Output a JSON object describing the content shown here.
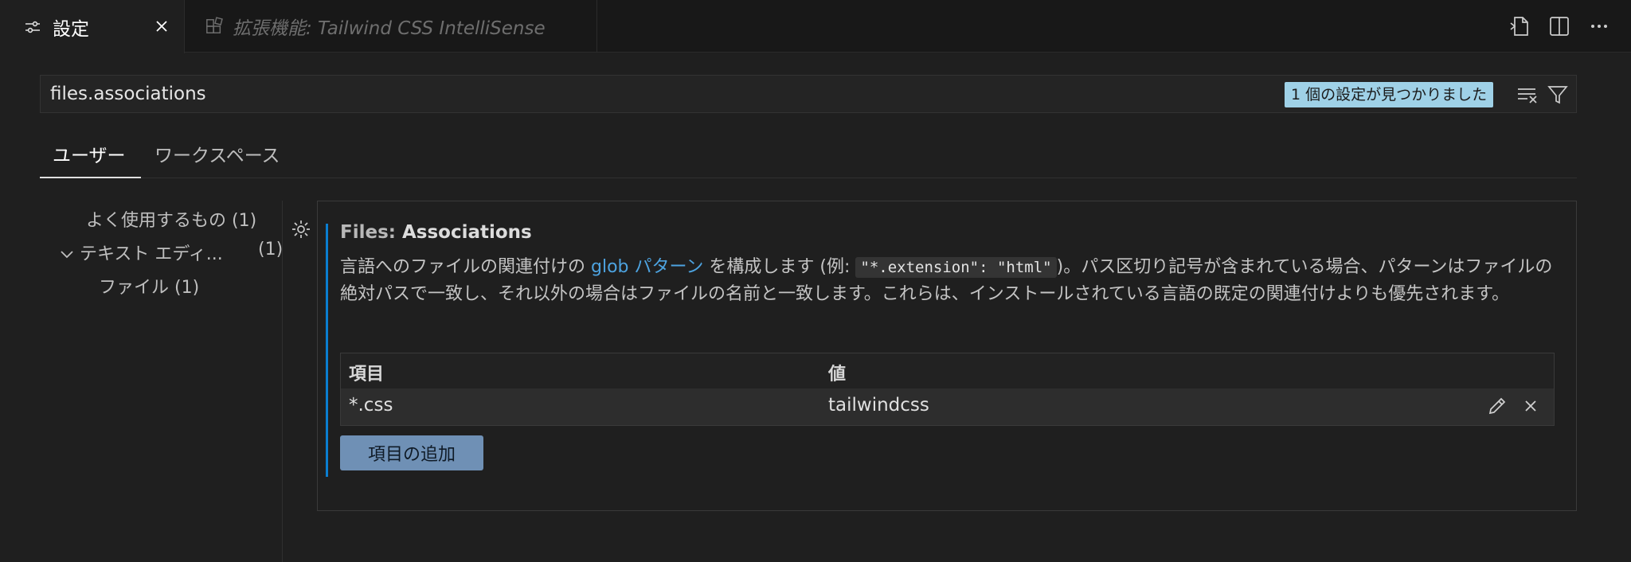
{
  "tabs": [
    {
      "label": "設定",
      "icon": "settings-sliders-icon",
      "active": true
    },
    {
      "label": "拡張機能: Tailwind CSS IntelliSense",
      "icon": "extensions-icon",
      "active": false
    }
  ],
  "tab_actions": [
    "open-settings-json-icon",
    "split-editor-icon",
    "more-actions-icon"
  ],
  "search": {
    "value": "files.associations",
    "result_count": "1 個の設定が見つかりました"
  },
  "scopes": {
    "user": "ユーザー",
    "workspace": "ワークスペース"
  },
  "toc": [
    {
      "label": "よく使用するもの (1)"
    },
    {
      "label": "テキスト エディ...",
      "count": "(1)",
      "expanded": true
    },
    {
      "label": "ファイル (1)"
    }
  ],
  "setting": {
    "category": "Files: ",
    "name": "Associations",
    "desc_part1": "言語へのファイルの関連付けの ",
    "desc_link": "glob パターン",
    "desc_part2": " を構成します (例: ",
    "desc_code": "\"*.extension\": \"html\"",
    "desc_part3": ")。パス区切り記号が含まれている場合、パターンはファイルの絶対パスで一致し、それ以外の場合はファイルの名前と一致します。これらは、インストールされている言語の既定の関連付けよりも優先されます。",
    "table": {
      "headers": {
        "item": "項目",
        "value": "値"
      },
      "rows": [
        {
          "item": "*.css",
          "value": "tailwindcss"
        }
      ]
    },
    "add_button": "項目の追加"
  },
  "colors": {
    "accent": "#0a7ed1",
    "badge": "#9fd1e7",
    "button": "#6f90b5",
    "link": "#4da3e0"
  }
}
